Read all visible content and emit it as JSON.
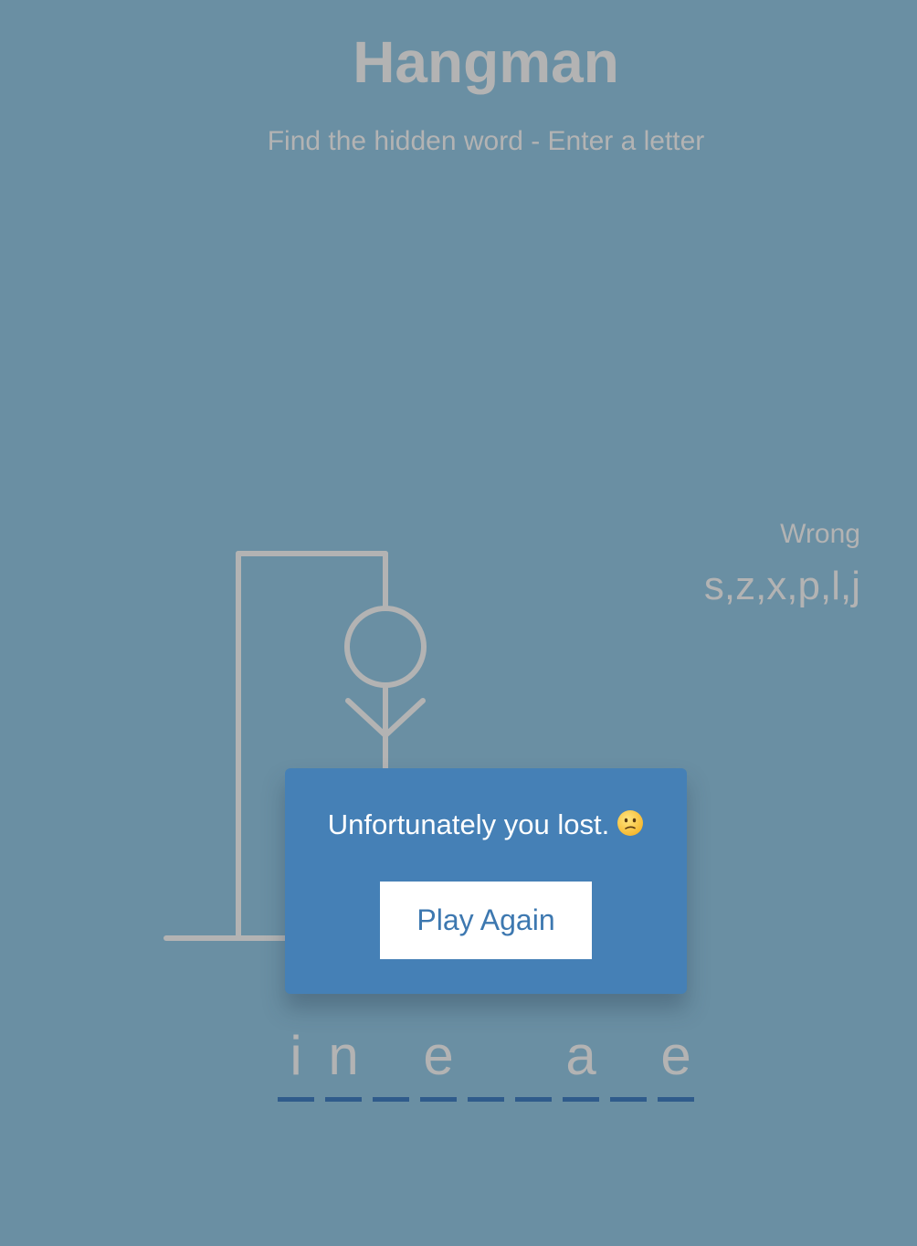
{
  "header": {
    "title": "Hangman",
    "subtitle": "Find the hidden word - Enter a letter"
  },
  "wrong": {
    "label": "Wrong",
    "letters": "s,z,x,p,l,j"
  },
  "word": {
    "slots": [
      "i",
      "n",
      "",
      "e",
      "",
      "",
      "a",
      "",
      "e"
    ]
  },
  "popup": {
    "message": "Unfortunately you lost.",
    "emoji": "confused-face-icon",
    "button_label": "Play Again"
  },
  "colors": {
    "background": "#6a8fa3",
    "figure": "#b3b3b3",
    "popup": "#4580b6",
    "underline": "#2f5b8b",
    "button_text": "#3d78b0"
  }
}
